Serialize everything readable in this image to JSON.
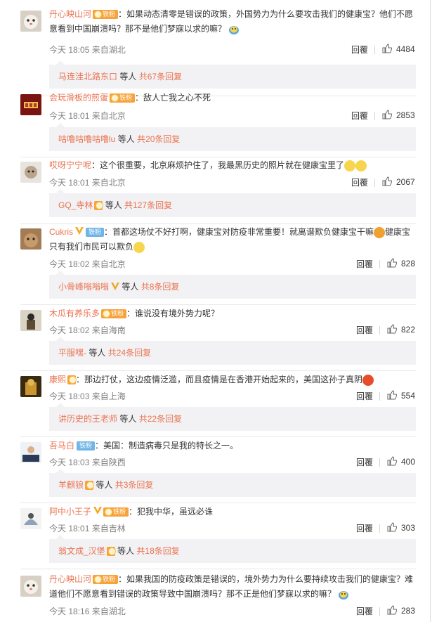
{
  "labels": {
    "reply": "回覆",
    "etc": "等人",
    "total_prefix": "共",
    "total_suffix": "条回复"
  },
  "colors": {
    "username": "#eb7350",
    "meta": "#808080",
    "subbox_bg": "#f2f2f5",
    "tiefen_badge": "#6fb5e7",
    "medal": "#f7a23a"
  },
  "comments": [
    {
      "user": "丹心映山河",
      "badge": "铁粉",
      "text": "：如果动态清零是错误的政策，外国势力为什么要攻击我们的健康宝？他们不愿意看到中国崩溃吗？那不是他们梦寐以求的嘛？",
      "meta": "今天 18:05 来自湖北",
      "likes": "4484",
      "sub_user": "马连洼北路东口",
      "sub_count": "67"
    },
    {
      "user": "会玩滑板的煎蛋",
      "badge": "铁粉",
      "text": "：敌人亡我之心不死",
      "meta": "今天 18:01 来自北京",
      "likes": "2853",
      "sub_user": "咕噜咕噜咕噜lu",
      "sub_count": "20"
    },
    {
      "user": "哎呀宁宁呢",
      "text": "：这个很重要，北京麻烦护住了，我最黑历史的照片就在健康宝里了",
      "meta": "今天 18:01 来自北京",
      "likes": "2067",
      "sub_user": "GQ_寺林",
      "sub_count": "127"
    },
    {
      "user": "Cukris",
      "badge": "铁粉",
      "text": "：首都这场仗不好打啊，健康宝对防疫非常重要！就离谱欺负健康宝干嘛",
      "text2": "健康宝只有我们市民可以欺负",
      "meta": "今天 18:02 来自北京",
      "likes": "828",
      "sub_user": "小骨峰嗡嗡嗡",
      "sub_count": "8"
    },
    {
      "user": "木瓜有养乐多",
      "badge": "铁粉",
      "text": "：谁说没有境外势力呢？",
      "meta": "今天 18:02 来自海南",
      "likes": "822",
      "sub_user": "平服嘿-",
      "sub_count": "24"
    },
    {
      "user": "康熙",
      "text": "：那边打仗，这边疫情泛滥，而且疫情是在香港开始起来的，美国这孙子真阴",
      "meta": "今天 18:03 来自上海",
      "likes": "554",
      "sub_user": "讲历史的王老师",
      "sub_count": "22"
    },
    {
      "user": "吾马白",
      "badge": "铁粉",
      "text": "：美国：制造病毒只是我的特长之一。",
      "meta": "今天 18:03 来自陕西",
      "likes": "400",
      "sub_user": "羊麒狼",
      "sub_count": "3"
    },
    {
      "user": "阿中小王子",
      "badge": "铁粉",
      "text": "：犯我中华，虽远必诛",
      "meta": "今天 18:01 来自吉林",
      "likes": "303",
      "sub_user": "翁文成_汉堡",
      "sub_count": "18"
    },
    {
      "user": "丹心映山河",
      "badge": "铁粉",
      "text": "：如果我国的防疫政策是错误的，境外势力为什么要持续攻击我们的健康宝？难道他们不愿意看到错误的政策导致中国崩溃吗？那不正是他们梦寐以求的嘛？",
      "meta": "今天 18:16 来自湖北",
      "likes": "283"
    }
  ]
}
